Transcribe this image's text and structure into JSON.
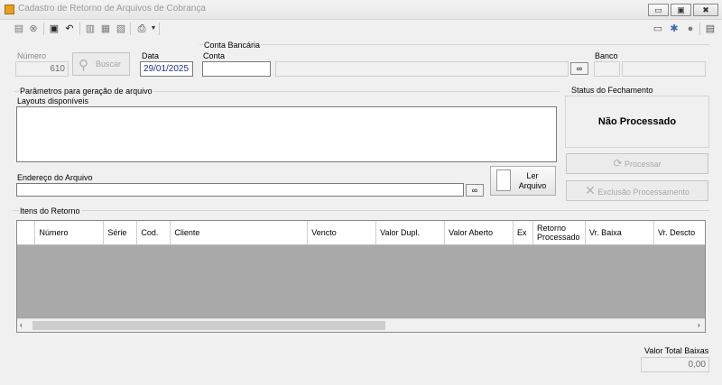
{
  "window": {
    "title": "Cadastro de Retorno de Arquivos de Cobrança",
    "minimize_glyph": "▭",
    "maximize_glyph": "▣",
    "close_glyph": "✖"
  },
  "toolbar": {
    "icons": [
      "new-icon",
      "cancel-icon",
      "save-icon",
      "undo-icon",
      "copy-icon",
      "cut-icon",
      "paste-icon",
      "print-icon"
    ],
    "right_icons": [
      "window-icon",
      "settings-icon",
      "user-icon",
      "panel-icon"
    ]
  },
  "header": {
    "numero_label": "Número",
    "numero_value": "610",
    "buscar_label": "Buscar",
    "data_label": "Data",
    "data_value": "29/01/2025",
    "conta_bancaria_label": "Conta Bancária",
    "conta_label": "Conta",
    "conta_value": "",
    "banco_label": "Banco"
  },
  "parametros": {
    "group_label": "Parâmetros para geração de arquivo",
    "layouts_label": "Layouts disponíveis",
    "endereco_label": "Endereço do Arquivo",
    "endereco_value": "",
    "ler_arquivo_label": "Ler Arquivo"
  },
  "status": {
    "group_label": "Status do Fechamento",
    "value": "Não Processado",
    "processar_label": "Processar",
    "exclusao_label": "Exclusão Processamento"
  },
  "itens": {
    "group_label": "Itens do Retorno",
    "columns": [
      "Número",
      "Série",
      "Cod.",
      "Cliente",
      "Vencto",
      "Valor Dupl.",
      "Valor Aberto",
      "Ex",
      "Retorno Processado",
      "Vr. Baixa",
      "Vr. Descto"
    ],
    "rows": []
  },
  "footer": {
    "total_label": "Valor Total Baixas",
    "total_value": "0,00"
  }
}
